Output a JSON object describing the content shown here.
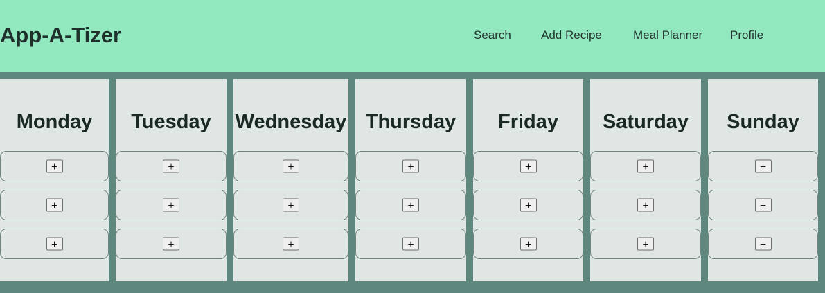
{
  "header": {
    "title": "App-A-Tizer",
    "nav": [
      {
        "label": "Search"
      },
      {
        "label": "Add Recipe"
      },
      {
        "label": "Meal Planner"
      },
      {
        "label": "Profile"
      }
    ]
  },
  "planner": {
    "days": [
      {
        "name": "Monday"
      },
      {
        "name": "Tuesday"
      },
      {
        "name": "Wednesday"
      },
      {
        "name": "Thursday"
      },
      {
        "name": "Friday"
      },
      {
        "name": "Saturday"
      },
      {
        "name": "Sunday"
      }
    ],
    "add_label": "+"
  },
  "colors": {
    "header_bg": "#92e9c0",
    "page_bg": "#5e877e",
    "column_bg": "#dfe6e3"
  }
}
